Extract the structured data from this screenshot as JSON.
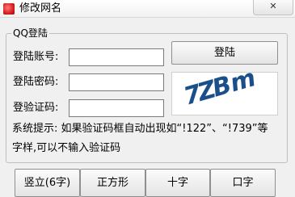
{
  "window": {
    "title": "修改网名",
    "close_symbol": "✕"
  },
  "group": {
    "title": "QQ登陆"
  },
  "form": {
    "account_label": "登陆账号:",
    "password_label": "登陆密码:",
    "captcha_label": "登验证码:",
    "account_value": "",
    "password_value": "",
    "captcha_value": ""
  },
  "login_button": "登陆",
  "captcha_image": {
    "text": "7ZB m"
  },
  "hint": {
    "line1": "系统提示: 如果验证码框自动出现如“!122”、“!739”等",
    "line2": "字样,可以不输入验证码"
  },
  "bottom_buttons": [
    "竖立(6字)",
    "正方形",
    "十字",
    "口字"
  ],
  "colors": {
    "captcha_ink": "#1a4f8a"
  }
}
